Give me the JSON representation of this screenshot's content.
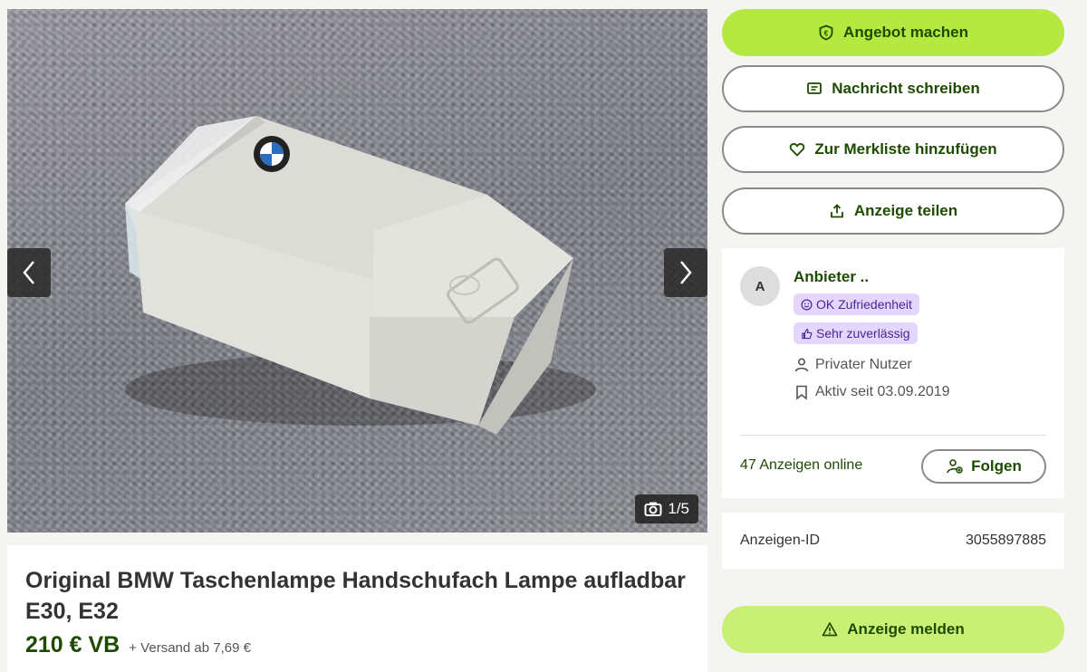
{
  "gallery": {
    "counter": "1/5",
    "image_alt": "BMW flashlight on grey carpet"
  },
  "listing": {
    "title": "Original BMW Taschenlampe Handschufach Lampe aufladbar E30, E32",
    "price": "210 € VB",
    "shipping": "+ Versand ab 7,69 €"
  },
  "actions": {
    "offer_label": "Angebot machen",
    "message_label": "Nachricht schreiben",
    "watchlist_label": "Zur Merkliste hinzufügen",
    "share_label": "Anzeige teilen",
    "report_label": "Anzeige melden"
  },
  "seller": {
    "avatar_letter": "A",
    "name": "Anbieter ..",
    "badge_satisfaction": "OK Zufriedenheit",
    "badge_reliability": "Sehr zuverlässig",
    "type": "Privater Nutzer",
    "active_since": "Aktiv seit 03.09.2019",
    "ads_online": "47 Anzeigen online",
    "follow_label": "Folgen"
  },
  "ad_id": {
    "label": "Anzeigen-ID",
    "value": "3055897885"
  },
  "colors": {
    "accent": "#b5e941",
    "accent_text": "#1d4b00",
    "badge_bg": "#e3d6ff"
  }
}
